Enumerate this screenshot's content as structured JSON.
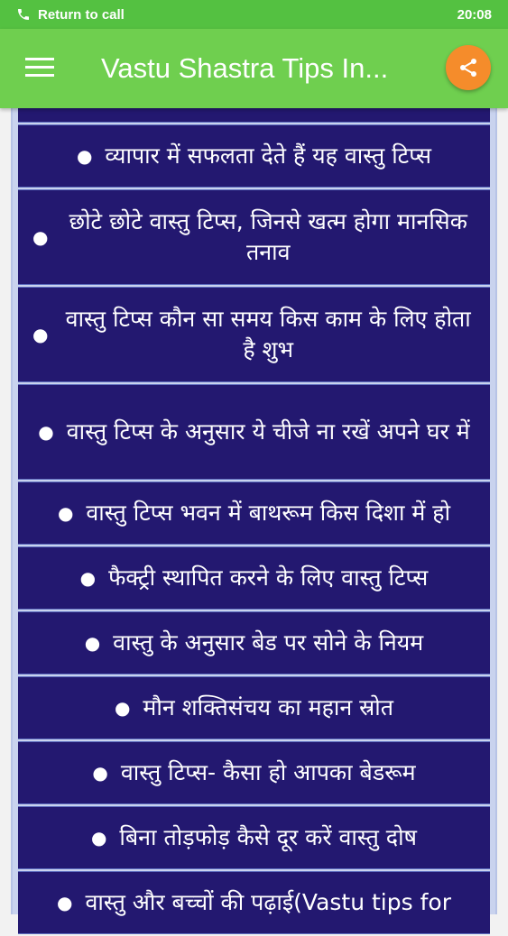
{
  "status_bar": {
    "call_text": "Return to call",
    "time": "20:08"
  },
  "app_bar": {
    "title": "Vastu Shastra Tips In...",
    "menu_icon": "hamburger-menu-icon",
    "share_icon": "share-icon",
    "share_color": "#f58c2b"
  },
  "items": [
    {
      "label": ""
    },
    {
      "label": "व्यापार में सफलता देते हैं यह वास्तु टिप्स"
    },
    {
      "label": "छोटे छोटे वास्तु टिप्स, जिनसे खत्म होगा मानसिक तनाव"
    },
    {
      "label": "वास्तु टिप्स कौन सा समय किस काम के लिए होता है शुभ"
    },
    {
      "label": "वास्तु टिप्स के अनुसार ये चीजे ना रखें अपने घर में"
    },
    {
      "label": "वास्तु टिप्स भवन में बाथरूम किस दिशा में हो"
    },
    {
      "label": "फैक्ट्री स्थापित करने के लिए वास्तु टिप्स"
    },
    {
      "label": "वास्तु के अनुसार बेड पर सोने के नियम"
    },
    {
      "label": "मौन शक्तिसंचय का महान स्रोत"
    },
    {
      "label": "वास्तु टिप्स- कैसा हो आपका बेडरूम"
    },
    {
      "label": "बिना तोड़फोड़ कैसे दूर करें वास्तु दोष"
    },
    {
      "label": "वास्तु और बच्चों की पढ़ाई(Vastu tips for"
    }
  ],
  "colors": {
    "status_bg": "#54c141",
    "appbar_bg": "#6fcf4f",
    "item_bg": "#231870",
    "item_border": "#5f6fc0"
  }
}
